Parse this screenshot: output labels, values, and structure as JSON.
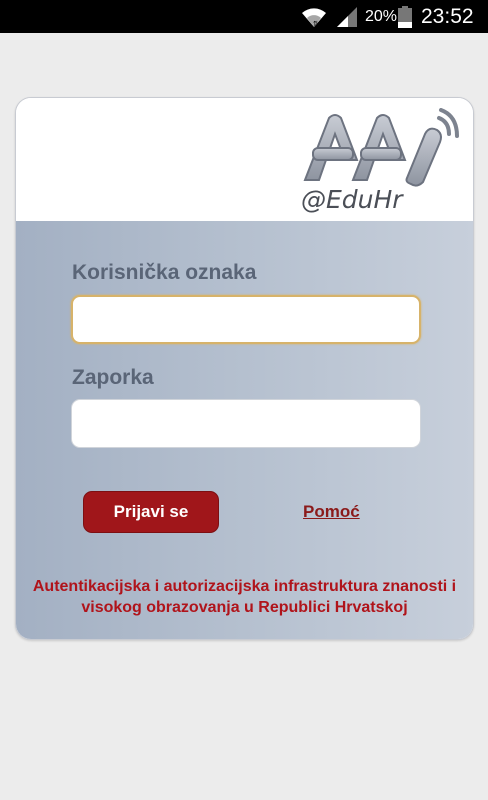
{
  "status_bar": {
    "battery_percent": "20%",
    "time": "23:52",
    "icons": [
      "wifi-icon",
      "signal-icon",
      "battery-icon"
    ]
  },
  "logo": {
    "letters": "AAI",
    "tagline": "@EduHr"
  },
  "form": {
    "username_label": "Korisnička oznaka",
    "username_value": "",
    "password_label": "Zaporka",
    "password_value": "",
    "login_button": "Prijavi se",
    "help_link": "Pomoć"
  },
  "footer": {
    "line1": "Autentikacijska i autorizacijska infrastruktura znanosti i",
    "line2": "visokog obrazovanja u Republici Hrvatskoj"
  },
  "colors": {
    "accent": "#a0161a",
    "label": "#5a6577",
    "focus_border": "#d7b36a"
  }
}
